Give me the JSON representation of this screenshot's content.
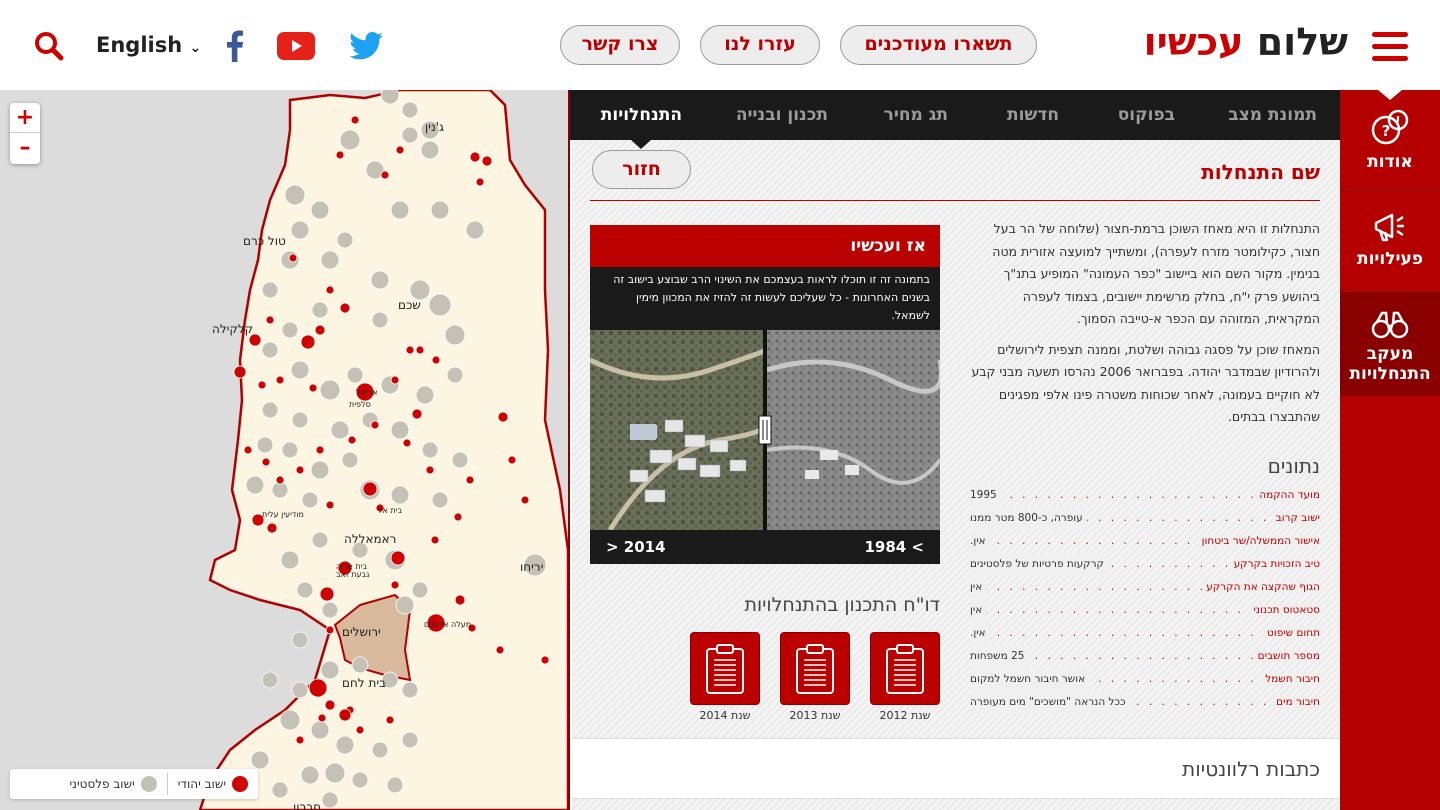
{
  "header": {
    "logo_part1": "שלום",
    "logo_part2": "עכשיו",
    "nav_buttons": [
      "תשארו מעודכנים",
      "עזרו לנו",
      "צרו קשר"
    ],
    "language": "English",
    "social": [
      "twitter-icon",
      "youtube-icon",
      "facebook-icon"
    ]
  },
  "sidenav": {
    "items": [
      {
        "label": "אודות",
        "icon": "question-bubble-icon"
      },
      {
        "label": "פעילויות",
        "icon": "megaphone-icon"
      },
      {
        "label": "מעקב התנחלויות",
        "icon": "binoculars-icon"
      }
    ]
  },
  "tabs": [
    "תמונת מצב",
    "בפוקוס",
    "חדשות",
    "תג מחיר",
    "תכנון ובנייה",
    "התנחלויות"
  ],
  "content": {
    "back_label": "חזור",
    "settlement_name": "שם התנחלות",
    "description": [
      "התנחלות זו היא מאחז השוכן ברמת-חצור (שלוחה של הר בעל חצור, כקילומטר מזרח לעפרה), ומשתייך למועצה אזורית מטה בנימין. מקור השם הוא ביישוב \"כפר העמונה\" המופיע בתנ\"ך ביהושע פרק י\"ח, בחלק מרשימת יישובים, בצמוד לעפרה המקראית, המזוהה עם הכפר א-טייבה הסמוך.",
      "המאחז שוכן על פסגה גבוהה ושלטת, וממנה תצפית לירושלים ולהרודיון שבמדבר יהודה. בפברואר 2006 נהרסו תשעה מבני קבע לא חוקיים בעמונה, לאחר שכוחות משטרה פינו אלפי מפגינים שהתבצרו בבתים."
    ],
    "data_title": "נתונים",
    "data_rows": [
      {
        "key": "מועד ההקמה",
        "value": "1995"
      },
      {
        "key": "ישוב קרוב",
        "value": "עופרה, כ-800 מטר ממנו"
      },
      {
        "key": "אישור הממשלה/שר ביטחון",
        "value": "אין."
      },
      {
        "key": "טיב הזכויות בקרקע",
        "value": "קרקעות פרטיות של פלסטינים"
      },
      {
        "key": "הגוף שהקצה את הקרקע",
        "value": "אין"
      },
      {
        "key": "סטאטוס תכנוני",
        "value": "אין"
      },
      {
        "key": "תחום שיפוט",
        "value": "אין."
      },
      {
        "key": "מספר תושבים",
        "value": "25 משפחות"
      },
      {
        "key": "חיבור חשמל",
        "value": "אושר חיבור חשמל למקום"
      },
      {
        "key": "חיבור מים",
        "value": "ככל הנראה \"מושכים\" מים מעופרה"
      }
    ],
    "then_now": {
      "title": "אז ועכשיו",
      "text": "בתמונה זה זו תוכלו לראות בעצמכם את השינוי הרב שבוצע בישוב זה בשנים האחרונות - כל שעליכם לעשות זה להזיז את המכוון מימין לשמאל.",
      "year_old": "1984 <",
      "year_new": "> 2014"
    },
    "plan_title": "דו\"ח התכנון בהתנחלויות",
    "reports": [
      "שנת 2012",
      "שנת 2013",
      "שנת 2014"
    ],
    "links_title": "כתבות רלוונטיות"
  },
  "map": {
    "labels": [
      "ג'נין",
      "טול כרם",
      "שכם",
      "קלקילה",
      "אריאל",
      "סלפית",
      "ראמאללה",
      "יריחו",
      "ירושלים",
      "בית לחם",
      "חברון",
      "מודיעין עלית",
      "בית אל",
      "בית אריה",
      "מעלה אדומים",
      "גבעת זאב"
    ],
    "legend_jewish": "ישוב יהודי",
    "legend_palestinian": "ישוב פלסטיני",
    "colors": {
      "jewish": "#d10000",
      "palestinian": "#c6c1b6",
      "border": "#b00000",
      "land": "#fbf5e1",
      "jerusalem": "#d8b99c"
    }
  }
}
